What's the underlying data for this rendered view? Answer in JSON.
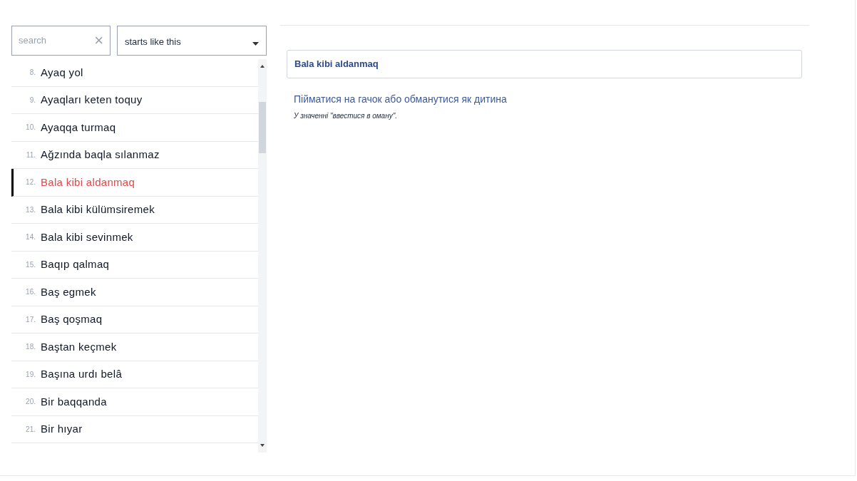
{
  "search": {
    "placeholder": "search",
    "clear": "×"
  },
  "filter": {
    "value": "starts like this"
  },
  "entries": [
    {
      "number": "8.",
      "text": "Ayaq yol",
      "selected": false
    },
    {
      "number": "9.",
      "text": "Ayaqları keten toquy",
      "selected": false
    },
    {
      "number": "10.",
      "text": "Ayaqqa turmaq",
      "selected": false
    },
    {
      "number": "11.",
      "text": "Ağzında baqla sılanmaz",
      "selected": false
    },
    {
      "number": "12.",
      "text": "Bala kibi aldanmaq",
      "selected": true
    },
    {
      "number": "13.",
      "text": "Bala kibi külümsiremek",
      "selected": false
    },
    {
      "number": "14.",
      "text": "Bala kibi sevinmek",
      "selected": false
    },
    {
      "number": "15.",
      "text": "Baqıp qalmaq",
      "selected": false
    },
    {
      "number": "16.",
      "text": "Baş egmek",
      "selected": false
    },
    {
      "number": "17.",
      "text": "Baş qoşmaq",
      "selected": false
    },
    {
      "number": "18.",
      "text": "Baştan keçmek",
      "selected": false
    },
    {
      "number": "19.",
      "text": "Başına urdı belâ",
      "selected": false
    },
    {
      "number": "20.",
      "text": "Bir baqqanda",
      "selected": false
    },
    {
      "number": "21.",
      "text": "Bir hıyar",
      "selected": false
    }
  ],
  "detail": {
    "title": "Bala kibi aldanmaq",
    "translation": "Пійматися на гачок або обманутися як дитина",
    "note": "У значенні \"ввестися в оману\"."
  }
}
